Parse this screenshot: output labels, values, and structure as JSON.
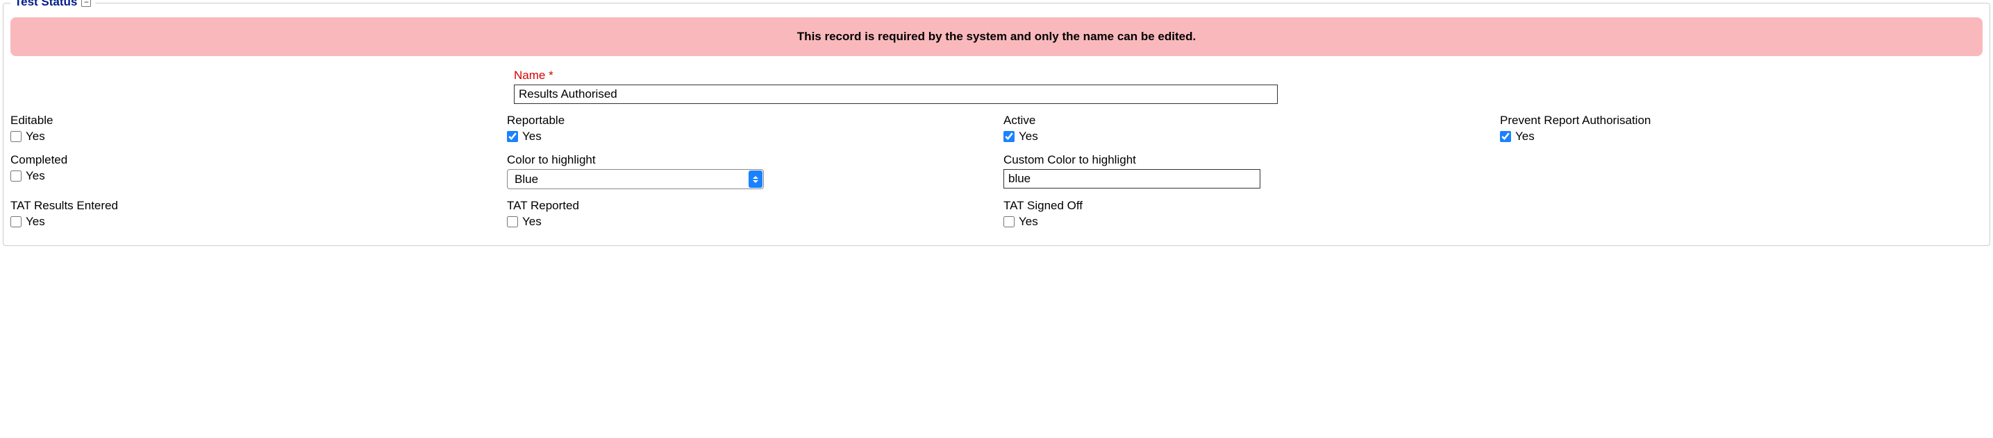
{
  "panel": {
    "title": "Test Status",
    "collapse_glyph": "−"
  },
  "alert": {
    "text": "This record is required by the system and only the name can be edited."
  },
  "fields": {
    "name": {
      "label": "Name",
      "required_marker": "*",
      "value": "Results Authorised"
    },
    "editable": {
      "label": "Editable",
      "yes": "Yes",
      "checked": false
    },
    "reportable": {
      "label": "Reportable",
      "yes": "Yes",
      "checked": true
    },
    "active": {
      "label": "Active",
      "yes": "Yes",
      "checked": true
    },
    "prevent_report_auth": {
      "label": "Prevent Report Authorisation",
      "yes": "Yes",
      "checked": true
    },
    "completed": {
      "label": "Completed",
      "yes": "Yes",
      "checked": false
    },
    "color_to_highlight": {
      "label": "Color to highlight",
      "value": "Blue"
    },
    "custom_color_to_highlight": {
      "label": "Custom Color to highlight",
      "value": "blue"
    },
    "tat_results_entered": {
      "label": "TAT Results Entered",
      "yes": "Yes",
      "checked": false
    },
    "tat_reported": {
      "label": "TAT Reported",
      "yes": "Yes",
      "checked": false
    },
    "tat_signed_off": {
      "label": "TAT Signed Off",
      "yes": "Yes",
      "checked": false
    }
  }
}
